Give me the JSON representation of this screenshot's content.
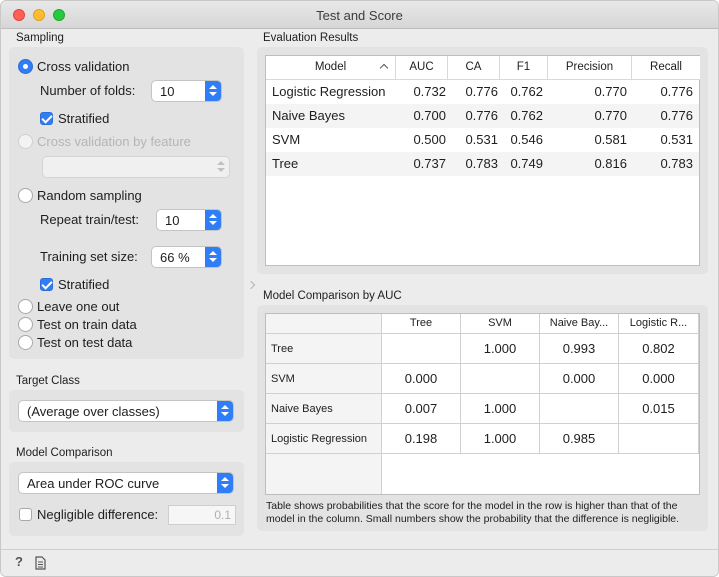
{
  "window": {
    "title": "Test and Score"
  },
  "sampling": {
    "title": "Sampling",
    "cross_validation": {
      "label": "Cross validation",
      "folds_label": "Number of folds:",
      "folds_value": "10",
      "stratified_label": "Stratified"
    },
    "cv_by_feature": {
      "label": "Cross validation by feature"
    },
    "random_sampling": {
      "label": "Random sampling",
      "repeat_label": "Repeat train/test:",
      "repeat_value": "10",
      "train_size_label": "Training set size:",
      "train_size_value": "66 %",
      "stratified_label": "Stratified"
    },
    "leave_one_out": "Leave one out",
    "test_on_train": "Test on train data",
    "test_on_test": "Test on test data"
  },
  "target_class": {
    "title": "Target Class",
    "value": "(Average over classes)"
  },
  "model_comparison": {
    "title": "Model Comparison",
    "value": "Area under ROC curve",
    "negligible_label": "Negligible difference:",
    "negligible_value": "0.1"
  },
  "evaluation": {
    "title": "Evaluation Results",
    "columns": [
      "Model",
      "AUC",
      "CA",
      "F1",
      "Precision",
      "Recall"
    ],
    "rows": [
      [
        "Logistic Regression",
        "0.732",
        "0.776",
        "0.762",
        "0.770",
        "0.776"
      ],
      [
        "Naive Bayes",
        "0.700",
        "0.776",
        "0.762",
        "0.770",
        "0.776"
      ],
      [
        "SVM",
        "0.500",
        "0.531",
        "0.546",
        "0.581",
        "0.531"
      ],
      [
        "Tree",
        "0.737",
        "0.783",
        "0.749",
        "0.816",
        "0.783"
      ]
    ]
  },
  "comparison": {
    "title": "Model Comparison by AUC",
    "columns": [
      "Tree",
      "SVM",
      "Naive Bay...",
      "Logistic R..."
    ],
    "rows": [
      {
        "label": "Tree",
        "cells": [
          "",
          "1.000",
          "0.993",
          "0.802"
        ]
      },
      {
        "label": "SVM",
        "cells": [
          "0.000",
          "",
          "0.000",
          "0.000"
        ]
      },
      {
        "label": "Naive Bayes",
        "cells": [
          "0.007",
          "1.000",
          "",
          "0.015"
        ]
      },
      {
        "label": "Logistic Regression",
        "cells": [
          "0.198",
          "1.000",
          "0.985",
          ""
        ]
      }
    ],
    "note": "Table shows probabilities that the score for the model in the row is higher than that of the model in the column. Small numbers show the probability that the difference is negligible."
  },
  "statusbar": {
    "help_icon": "?",
    "report_icon": "report-icon"
  }
}
